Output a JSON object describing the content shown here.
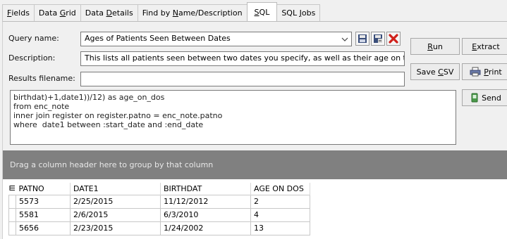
{
  "tabs": [
    {
      "label": "Fields",
      "accel": "F",
      "rest": "ields"
    },
    {
      "label": "Data Grid",
      "pre": "Data ",
      "accel": "G",
      "rest": "rid"
    },
    {
      "label": "Data Details",
      "pre": "Data ",
      "accel": "D",
      "rest": "etails"
    },
    {
      "label": "Find by Name/Description",
      "pre": "Find by ",
      "accel": "N",
      "rest": "ame/Description"
    },
    {
      "label": "SQL",
      "accel": "S",
      "rest": "QL",
      "active": true
    },
    {
      "label": "SQL Jobs",
      "pre": "SQL ",
      "accel": "J",
      "rest": "obs"
    }
  ],
  "form": {
    "query_name_label": "Query name:",
    "query_name_value": "Ages of Patients Seen Between Dates",
    "description_label": "Description:",
    "description_value": "This lists all patients seen between two dates you specify, as well as their age on t",
    "results_filename_label": "Results filename:",
    "results_filename_value": ""
  },
  "buttons": {
    "run": {
      "accel": "R",
      "rest": "un"
    },
    "extract": {
      "accel": "E",
      "rest": "xtract"
    },
    "save_csv": {
      "pre": "Save ",
      "accel": "C",
      "rest": "SV"
    },
    "print": {
      "accel": "P",
      "rest": "rint"
    },
    "send": {
      "label": "Send"
    }
  },
  "icons": {
    "combo_arrow": "chevron-down-icon",
    "save_query": "floppy-disk-icon",
    "save_as_query": "floppy-disk-arrow-icon",
    "delete_query": "red-x-icon",
    "print": "printer-icon",
    "send": "send-phone-icon",
    "grid_menu": "column-chooser-icon"
  },
  "sql_lines": [
    "birthdat)+1,date1))/12) as age_on_dos",
    "from enc_note",
    "inner join register on register.patno = enc_note.patno",
    "where  date1 between :start_date and :end_date"
  ],
  "group_bar_text": "Drag a column header here to group by that column",
  "grid": {
    "columns": [
      "PATNO",
      "DATE1",
      "BIRTHDAT",
      "AGE ON DOS"
    ],
    "rows": [
      [
        "5573",
        "2/25/2015",
        "11/12/2012",
        "2"
      ],
      [
        "5581",
        "2/6/2015",
        "6/3/2010",
        "4"
      ],
      [
        "5656",
        "2/23/2015",
        "1/24/2002",
        "13"
      ]
    ]
  }
}
